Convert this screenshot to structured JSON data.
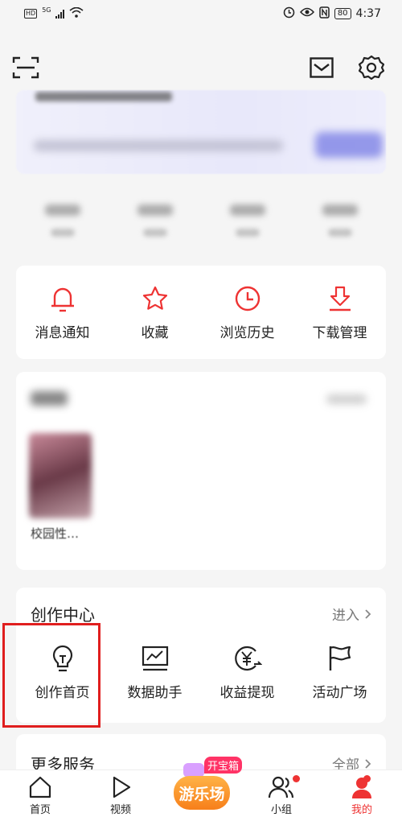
{
  "status_bar": {
    "network_badge": "HD",
    "network_type": "5G",
    "battery": "80",
    "time": "4:37"
  },
  "header": {
    "scan_icon": "scan-icon",
    "mail_icon": "mail-icon",
    "settings_icon": "gear-icon"
  },
  "quick_actions": [
    {
      "label": "消息通知",
      "icon": "bell-icon"
    },
    {
      "label": "收藏",
      "icon": "star-icon"
    },
    {
      "label": "浏览历史",
      "icon": "clock-icon"
    },
    {
      "label": "下载管理",
      "icon": "download-icon"
    }
  ],
  "history": {
    "caption": "校园性…"
  },
  "creation_center": {
    "title": "创作中心",
    "enter_label": "进入",
    "items": [
      {
        "label": "创作首页",
        "icon": "lightbulb-icon"
      },
      {
        "label": "数据助手",
        "icon": "chart-icon"
      },
      {
        "label": "收益提现",
        "icon": "yen-icon"
      },
      {
        "label": "活动广场",
        "icon": "flag-icon"
      }
    ]
  },
  "more_services": {
    "title": "更多服务",
    "all_label": "全部"
  },
  "bottom_nav": {
    "items": [
      {
        "label": "首页",
        "icon": "home-icon"
      },
      {
        "label": "视频",
        "icon": "play-icon"
      },
      {
        "label": "小组",
        "icon": "group-icon"
      },
      {
        "label": "我的",
        "icon": "profile-icon"
      }
    ],
    "center": {
      "label": "游乐场",
      "tag": "开宝箱"
    }
  },
  "colors": {
    "accent_red": "#e33333",
    "highlight_box": "#e01e1e",
    "background": "#f5f5f5"
  }
}
